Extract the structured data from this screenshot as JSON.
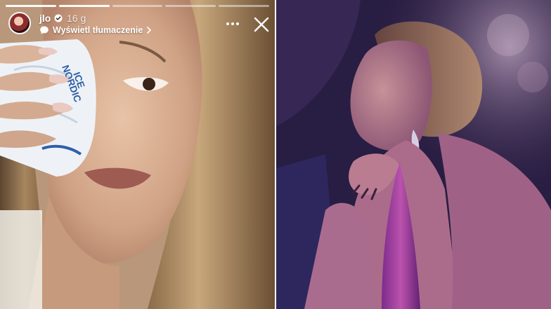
{
  "story": {
    "username": "jlo",
    "timestamp": "16 g",
    "translate_label": "Wyświetl tłumaczenie",
    "pack_brand_line1": "NORDIC",
    "pack_brand_line2": "ICE",
    "progress_segments": [
      true,
      true,
      false,
      false,
      false
    ],
    "icons": [
      "avatar",
      "verified-badge-icon",
      "translate-icon",
      "chevron-right-icon",
      "more-icon",
      "close-icon"
    ]
  },
  "colors": {
    "overlay_text": "#ffffff",
    "divider": "#ffffff"
  }
}
